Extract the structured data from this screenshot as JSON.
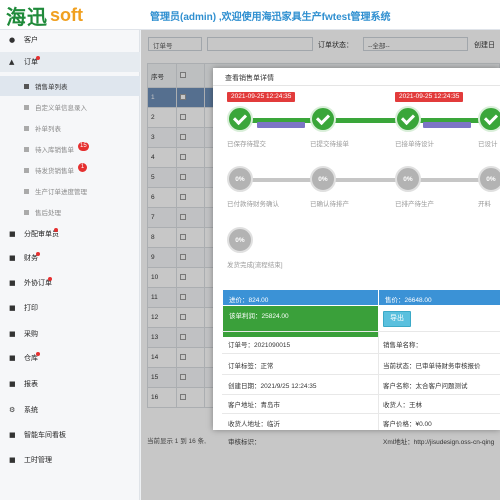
{
  "header": {
    "logo_cn": "海迅",
    "logo_en": "soft",
    "title": "管理员(admin) ,欢迎使用海迅家具生产fwtest管理系统"
  },
  "sidebar": {
    "items": [
      {
        "label": "客户",
        "icon": "person-icon",
        "level": 1
      },
      {
        "label": "订单",
        "icon": "cart-icon",
        "level": 1,
        "dot": true
      },
      {
        "label": "销售单列表",
        "level": 2
      },
      {
        "label": "自定义单信息录入",
        "level": 2
      },
      {
        "label": "补单列表",
        "level": 2
      },
      {
        "label": "待入库销售单",
        "level": 2,
        "badge": "15"
      },
      {
        "label": "待发货销售单",
        "level": 2,
        "badge": "1"
      },
      {
        "label": "生产订单进度管理",
        "level": 2
      },
      {
        "label": "售后处理",
        "level": 2
      },
      {
        "label": "分配审单员",
        "icon": "group-icon",
        "level": 1,
        "dot": true
      },
      {
        "label": "财务",
        "icon": "finance-icon",
        "level": 1,
        "dot": true
      },
      {
        "label": "外协订单",
        "icon": "external-icon",
        "level": 1,
        "dot": true
      },
      {
        "label": "打印",
        "icon": "print-icon",
        "level": 1
      },
      {
        "label": "采购",
        "icon": "purchase-icon",
        "level": 1
      },
      {
        "label": "仓库",
        "icon": "warehouse-icon",
        "level": 1,
        "dot": true
      },
      {
        "label": "报表",
        "icon": "report-icon",
        "level": 1
      },
      {
        "label": "系统",
        "icon": "gear-icon",
        "level": 1
      },
      {
        "label": "智能车间看板",
        "icon": "dashboard-icon",
        "level": 1
      },
      {
        "label": "工时管理",
        "icon": "clock-icon",
        "level": 1
      }
    ]
  },
  "toolbar": {
    "order_no_label": "订单号",
    "order_status_label": "订单状态：",
    "order_status_value": "--全部--",
    "created_label": "创建日"
  },
  "table": {
    "headers": [
      "序号",
      ""
    ],
    "rows": [
      "1",
      "2",
      "3",
      "4",
      "5",
      "6",
      "7",
      "8",
      "9",
      "10",
      "11",
      "12",
      "13",
      "14",
      "15",
      "16"
    ]
  },
  "footer": {
    "text": "当前显示 1 到 16 条,"
  },
  "modal": {
    "title": "查看销售单详情",
    "steps_row1": [
      {
        "label": "已保存待提交",
        "date": "2021-09-25 12:24:35",
        "state": "done"
      },
      {
        "label": "已提交待接单",
        "state": "done"
      },
      {
        "label": "已接单待设计",
        "date": "2021-09-25 12:24:35",
        "state": "done"
      },
      {
        "label": "已设计",
        "state": "done"
      }
    ],
    "steps_row2": [
      {
        "label": "已付款待财务确认",
        "value": "0%"
      },
      {
        "label": "已确认待排产",
        "value": "0%"
      },
      {
        "label": "已排产待生产",
        "value": "0%"
      },
      {
        "label": "开料",
        "value": "0%"
      }
    ],
    "steps_row3": [
      {
        "label": "发货完成[流程结束]",
        "value": "0%"
      }
    ],
    "summary": {
      "purchase": "进价：824.00",
      "sale": "售价：26648.00",
      "profit": "该单利润：25824.00",
      "export_btn": "导出"
    },
    "details": [
      [
        "订单号：2021090015",
        "销售单名称："
      ],
      [
        "订单标签：正常",
        "当前状态：已审单待财务审核报价"
      ],
      [
        "创建日期：2021/9/25 12:24:35",
        "客户名称：太合客户问题测试"
      ],
      [
        "客户地址：青岛市",
        "收货人：王林"
      ],
      [
        "收货人地址：临沂",
        "客户价格：¥0.00"
      ],
      [
        "审核标识：",
        "Xml地址：http://jisudesign.oss-cn-qing"
      ]
    ],
    "colors": {
      "green": "#3aa63a",
      "red": "#e23b3b",
      "purple": "#7d74c6",
      "blue": "#2f8fd0"
    }
  }
}
